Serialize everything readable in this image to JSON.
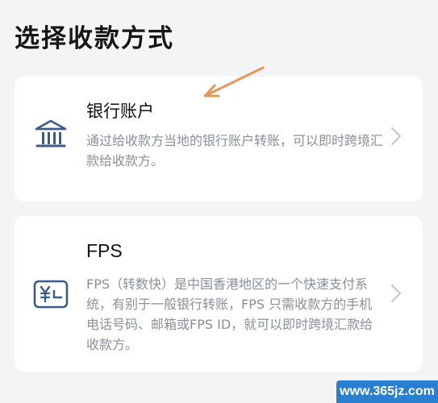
{
  "page": {
    "title": "选择收款方式"
  },
  "methods": [
    {
      "title": "银行账户",
      "description": "通过给收款方当地的银行账户转账，可以即时跨境汇款给收款方。",
      "icon": "bank-icon"
    },
    {
      "title": "FPS",
      "description": "FPS（转数快）是中国香港地区的一个快速支付系统，有别于一般银行转账，FPS 只需收款方的手机电话号码、邮箱或FPS ID，就可以即时跨境汇款给收款方。",
      "icon": "fps-yuan-icon"
    }
  ],
  "annotation": {
    "arrow_color": "#e6975a"
  },
  "watermark": {
    "text": "www.365jz.com"
  },
  "colors": {
    "background": "#f4f4f6",
    "card": "#ffffff",
    "icon": "#3c5a8a",
    "description": "#8a8f99",
    "chevron": "#c3c6cc"
  }
}
